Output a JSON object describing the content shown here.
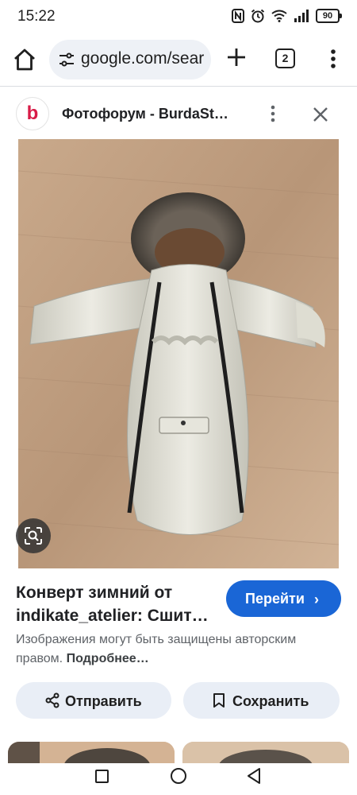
{
  "status_bar": {
    "time": "15:22",
    "battery": "90",
    "icons": [
      "nfc-icon",
      "alarm-icon",
      "wifi-icon",
      "signal-icon",
      "battery-icon"
    ]
  },
  "browser": {
    "url": "google.com/sear",
    "tab_count": "2"
  },
  "source": {
    "logo_letter": "b",
    "title": "Фотофорум - BurdaSt…"
  },
  "result": {
    "title_line1": "Конверт зимний от",
    "title_line2": "indikate_atelier: Сшит…",
    "goto_label": "Перейти",
    "goto_chevron": "›",
    "copyright_text": "Изображения могут быть защищены авторским правом.",
    "copyright_more": "Подробнее…",
    "share_label": "Отправить",
    "save_label": "Сохранить"
  },
  "colors": {
    "accent": "#1a66d6",
    "pill_bg": "#e9eef6",
    "url_bg": "#eef1f6",
    "brand_logo": "#d81b47"
  }
}
